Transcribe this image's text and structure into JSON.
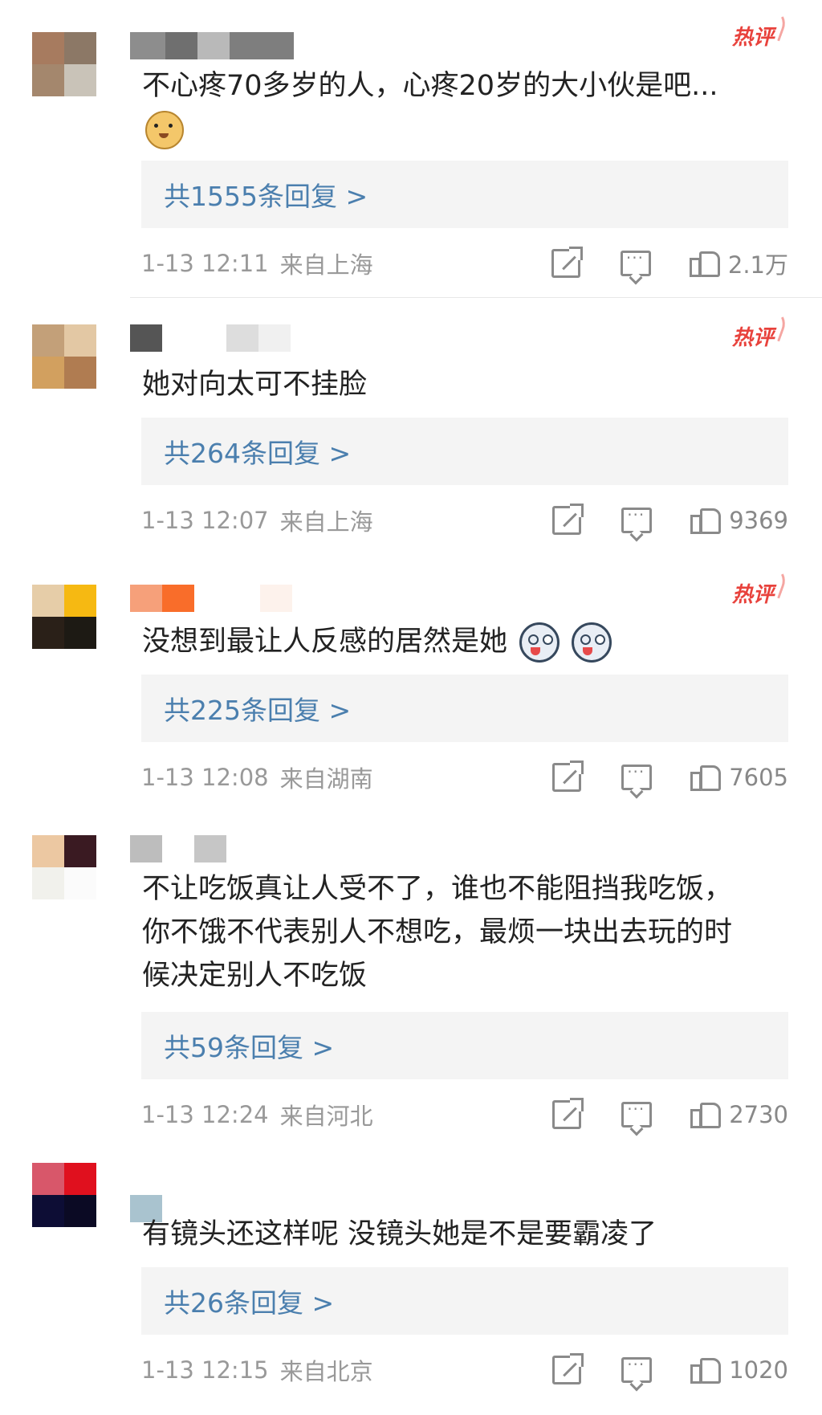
{
  "comments": [
    {
      "avatar": [
        "#a77b5f",
        "#8c7866",
        "#a4876d",
        "#c9c3b8"
      ],
      "username_blocks": [
        "#8d8d8d",
        "#6f6f6f",
        "#b9b9b9",
        "#7e7e7e"
      ],
      "hot": "热评",
      "text": "不心疼70多岁的人，心疼20岁的大小伙是吧...",
      "emoji": [
        "doge-icon"
      ],
      "replies": "共1555条回复 >",
      "time": "1-13 12:11",
      "location": "来自上海",
      "likes": "2.1万"
    },
    {
      "avatar": [
        "#c3a079",
        "#e3c8a4",
        "#d2a05f",
        "#b07c51"
      ],
      "username_blocks": [
        "#555555",
        "#ffffff",
        "#dddddd",
        "#f0f0f0"
      ],
      "hot": "热评",
      "text": "她对向太可不挂脸",
      "emoji": [],
      "replies": "共264条回复 >",
      "time": "1-13 12:07",
      "location": "来自上海",
      "likes": "9369"
    },
    {
      "avatar": [
        "#e6cda8",
        "#f6b912",
        "#2a2018",
        "#1d1a14"
      ],
      "username_blocks": [
        "#f6a07a",
        "#f96d2a",
        "#ffffff",
        "#fdf2ec"
      ],
      "hot": "热评",
      "text": "没想到最让人反感的居然是她",
      "emoji": [
        "husky-icon",
        "husky-icon"
      ],
      "replies": "共225条回复 >",
      "time": "1-13 12:08",
      "location": "来自湖南",
      "likes": "7605"
    },
    {
      "avatar": [
        "#ecc8a2",
        "#3a1a22",
        "#f1f1ec",
        "#fbfbfb"
      ],
      "username_blocks": [
        "#bdbdbd",
        "#ffffff",
        "#c6c6c6",
        "#ffffff"
      ],
      "hot": "",
      "text_lines": [
        "不让吃饭真让人受不了，谁也不能阻挡我吃饭，",
        "你不饿不代表别人不想吃，最烦一块出去玩的时",
        "候决定别人不吃饭"
      ],
      "emoji": [],
      "replies": "共59条回复 >",
      "time": "1-13 12:24",
      "location": "来自河北",
      "likes": "2730"
    },
    {
      "avatar": [
        "#d8576a",
        "#e0101e",
        "#0d0d35",
        "#0b0a24"
      ],
      "username_blocks": [
        "#a9c3cf",
        "#ffffff",
        "#ffffff",
        "#ffffff"
      ],
      "hot": "",
      "text": "有镜头还这样呢 没镜头她是不是要霸凌了",
      "emoji": [],
      "replies": "共26条回复 >",
      "time": "1-13 12:15",
      "location": "来自北京",
      "likes": "1020"
    }
  ]
}
